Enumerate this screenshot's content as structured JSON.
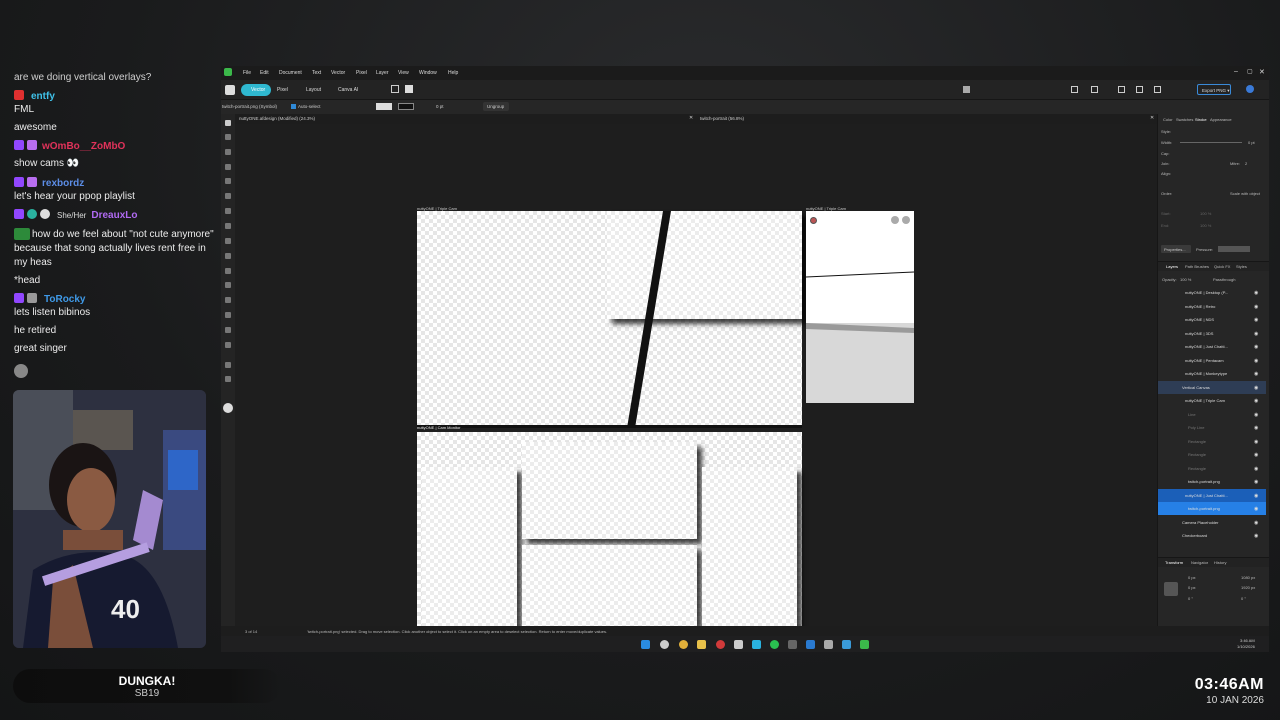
{
  "chat": {
    "messages": [
      {
        "user": "",
        "text": "are we doing vertical overlays?"
      },
      {
        "user": "entfy",
        "text": "FML",
        "user_color": "#3fc1e8"
      },
      {
        "user": "",
        "text": "awesome"
      },
      {
        "user": "wOmBo__ZoMbO",
        "text": "show cams 👀",
        "user_color": "#e0325a"
      },
      {
        "user": "rexbordz",
        "text": "let's hear your ppop playlist",
        "user_color": "#5c8de6"
      },
      {
        "user": "DreauxLo",
        "pronoun": "She/Her",
        "text": "how do we feel about \"not cute anymore\" because that song actually lives rent free in my heas",
        "user_color": "#b06af2"
      },
      {
        "user": "",
        "text": "*head"
      },
      {
        "user": "ToRocky",
        "text": "lets listen bibinos",
        "user_color": "#3f9ae8"
      },
      {
        "user": "",
        "text": "he retired"
      },
      {
        "user": "",
        "text": "great singer"
      }
    ]
  },
  "ticker": {
    "artist": "DUNGKA!",
    "song": "SB19"
  },
  "clock": {
    "time": "03:46AM",
    "date": "10 JAN 2026"
  },
  "app": {
    "menu": [
      "File",
      "Edit",
      "Document",
      "Text",
      "Vector",
      "Pixel",
      "Layer",
      "View",
      "Window",
      "Help"
    ],
    "personas": [
      "Vector",
      "Pixel",
      "Layout",
      "Canva AI"
    ],
    "export_label": "Export PNG",
    "context": {
      "file": "twitch-portrait.png (Symbol)",
      "autoselect": "Auto-select",
      "stroke": "0 pt",
      "ungroup": "Ungroup"
    },
    "tabs": [
      "nuttyONE.afdesign (Modified) (24.3%)",
      "twitch-portrait (56.8%)"
    ],
    "artboards": {
      "triple_cam": "nuttyONE | Triple Cam",
      "triple_cam_small": "nuttyONE | Triple Cam",
      "cam_bottom": "nuttyONE | Cam Monitor"
    },
    "panels": {
      "tabs1": [
        "Color",
        "Swatches",
        "Stroke",
        "Appearance"
      ],
      "style": "Style:",
      "width": "Width:",
      "width_val": "0 pt",
      "cap": "Cap:",
      "join": "Join:",
      "mitre": "Mitre:",
      "mitre_val": "2",
      "align": "Align:",
      "order": "Order:",
      "scale": "Scale with object",
      "start": "Start:",
      "end": "End:",
      "start_pct": "100 %",
      "end_pct": "100 %",
      "properties": "Properties...",
      "pressure": "Pressure:"
    },
    "layers": {
      "tabs": [
        "Layers",
        "Path Brushes",
        "Quick FX",
        "Styles"
      ],
      "opacity": "Opacity:",
      "opacity_val": "100 %",
      "blend": "Passthrough",
      "rows": [
        "nuttyONE | Desktop (P...",
        "nuttyONE | Retro",
        "nuttyONE | NDS",
        "nuttyONE | 3DS",
        "nuttyONE | Just Chatti...",
        "nuttyONE | Pentacam",
        "nuttyONE | Monkeytype",
        "Vertical Canvas",
        "nuttyONE | Triple Cam",
        "Line",
        "Poly Line",
        "Rectangle",
        "Rectangle",
        "Rectangle",
        "twitch-portrait.png",
        "nuttyONE | Just Chatti...",
        "twitch-portrait.png",
        "Camera Placeholder",
        "Checkerboard"
      ]
    },
    "transform": {
      "tabs": [
        "Transform",
        "Navigator",
        "History"
      ],
      "x": "0 px",
      "y": "0 px",
      "w": "1080 px",
      "h": "1920 px",
      "r": "0 °",
      "s": "0 °"
    },
    "status": {
      "page": "3 of 14",
      "message": "'twitch-portrait.png' selected. Drag to move selection. Click another object to select it. Click on an empty area to deselect selection. Return to enter move/duplicate values."
    },
    "tray": {
      "time": "3:46 AM",
      "date": "1/10/2026"
    }
  }
}
